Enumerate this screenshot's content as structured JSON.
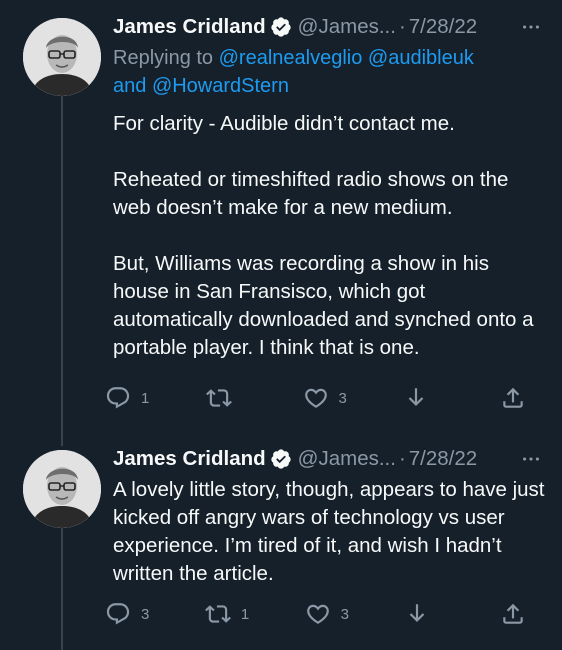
{
  "colors": {
    "background": "#15202b",
    "text": "#f7f9f9",
    "secondary": "#8b98a5",
    "link": "#1d9bf0",
    "thread_line": "#38444d"
  },
  "tweets": [
    {
      "author_name": "James Cridland",
      "handle": "@James...",
      "separator": "·",
      "date": "7/28/22",
      "reply_prefix": "Replying to",
      "reply_mention_1": "@realnealveglio",
      "reply_mention_2": "@audibleuk",
      "reply_and": "and",
      "reply_mention_3": "@HowardStern",
      "text": "For clarity - Audible didn’t contact me.\n\nReheated or timeshifted radio shows on the web doesn’t make for a new medium.\n\nBut, Williams was recording a show in his house in San Fransisco, which got automatically downloaded and synched onto a portable player. I think that is one.",
      "reply_count": "1",
      "retweet_count": "",
      "like_count": "3"
    },
    {
      "author_name": "James Cridland",
      "handle": "@James...",
      "separator": "·",
      "date": "7/28/22",
      "text": "A lovely little story, though, appears to have just kicked off angry wars of technology vs user experience. I’m tired of it, and wish I hadn’t written the article.",
      "reply_count": "3",
      "retweet_count": "1",
      "like_count": "3"
    }
  ]
}
